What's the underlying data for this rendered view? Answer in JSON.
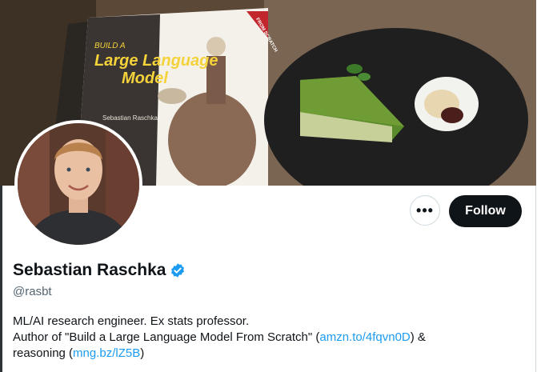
{
  "banner": {
    "book_subtitle": "BUILD A",
    "book_title_line1": "Large Language",
    "book_title_line2": "Model",
    "book_author": "Sebastian Raschka",
    "book_badge": "FROM SCRATCH"
  },
  "actions": {
    "more_label": "•••",
    "follow_label": "Follow"
  },
  "profile": {
    "name": "Sebastian Raschka",
    "handle": "@rasbt",
    "verified": true
  },
  "bio": {
    "line1": "ML/AI research engineer. Ex stats professor.",
    "line2_prefix": "Author of \"Build a Large Language Model From Scratch\" (",
    "link1": "amzn.to/4fqvn0D",
    "line2_suffix": ") &",
    "line3_prefix": "reasoning (",
    "link2": "mng.bz/lZ5B",
    "line3_suffix": ")"
  },
  "colors": {
    "accent": "#1d9bf0",
    "text": "#0f1419",
    "secondary": "#536471",
    "button_dark": "#0f1419"
  }
}
